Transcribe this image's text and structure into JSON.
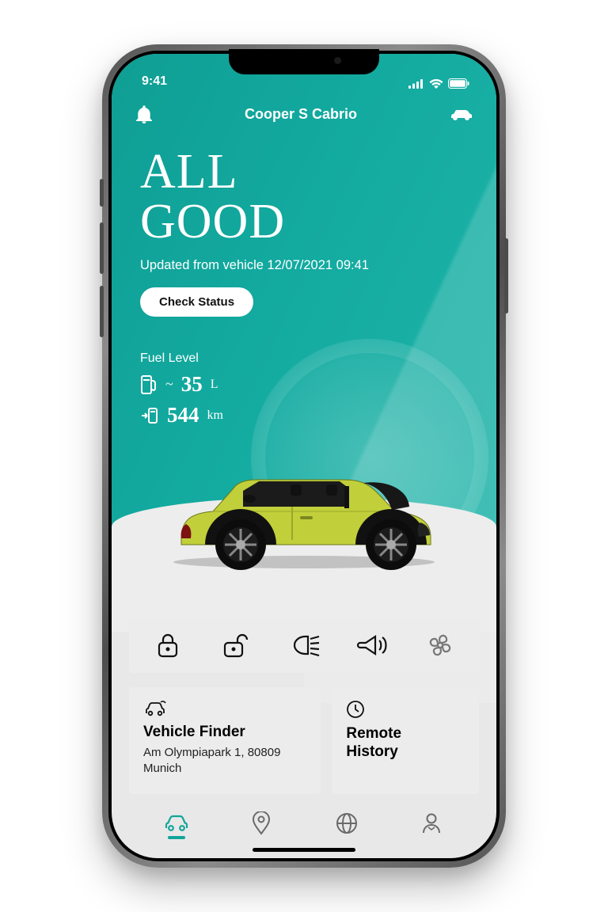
{
  "status_bar": {
    "time": "9:41"
  },
  "app_bar": {
    "title": "Cooper S Cabrio"
  },
  "hero": {
    "headline_l1": "ALL",
    "headline_l2": "GOOD",
    "subtitle": "Updated from vehicle 12/07/2021 09:41",
    "button": "Check Status"
  },
  "fuel": {
    "label": "Fuel Level",
    "level_approx": "~",
    "level_value": "35",
    "level_unit": "L",
    "range_value": "544",
    "range_unit": "km"
  },
  "cards": {
    "finder": {
      "title": "Vehicle Finder",
      "address": "Am Olympiapark 1, 80809 Munich"
    },
    "history": {
      "title_l1": "Remote",
      "title_l2": "History"
    }
  },
  "colors": {
    "accent": "#12a59a",
    "car_body": "#bfc93e"
  }
}
